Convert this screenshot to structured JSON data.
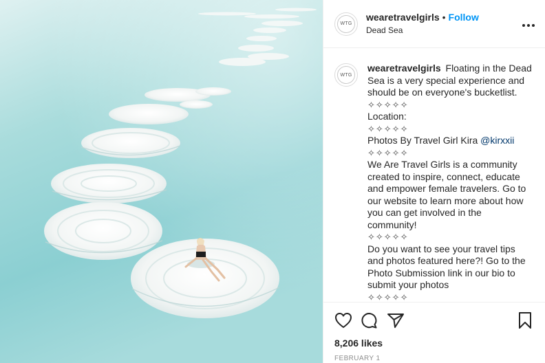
{
  "post": {
    "username": "weare travelgirls",
    "location": "Dead Sea",
    "follow_label": "Follow",
    "separator": "•",
    "more_label": "•••",
    "avatar_mark": "WTG"
  },
  "caption": {
    "username": "wearetravelgirls",
    "text": "Floating in the Dead Sea is a very special experience and should be on everyone's bucketlist.",
    "symbols": "✧✧✧✧✧",
    "location_label": "Location:",
    "credit_prefix": "Photos By Travel Girl Kira",
    "mention": "@kirxxii",
    "community_text": "We Are Travel Girls is a community created to inspire, connect, educate and empower female travelers. Go to our website to learn more about how you can get involved in the community!",
    "submission_text": "Do you want to see your travel tips and photos featured here?! Go to the Photo Submission link in our bio to submit your photos"
  },
  "actions": {
    "likes": "8,206 likes",
    "date": "FEBRUARY 1",
    "icons": [
      "heart-icon",
      "comment-icon",
      "share-icon",
      "bookmark-icon"
    ]
  },
  "colors": {
    "follow": "#0095f6",
    "mention": "#00376b",
    "water": "#8fd3d6",
    "salt": "#f4f6f5"
  }
}
